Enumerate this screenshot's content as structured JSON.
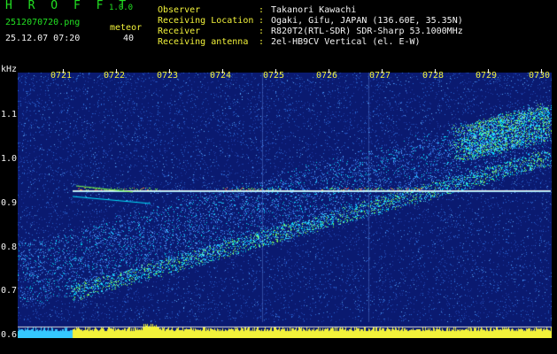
{
  "header": {
    "app_name": "H R O F F T",
    "version": "1.0.0",
    "file_name": "2512070720.png",
    "datetime": "25.12.07 07:20",
    "meteor_label": "meteor",
    "meteor_count": "40"
  },
  "info": {
    "rows": [
      {
        "label": "Observer",
        "value": "Takanori Kawachi"
      },
      {
        "label": "Receiving Location",
        "value": "Ogaki, Gifu, JAPAN (136.60E, 35.35N)"
      },
      {
        "label": "Receiver",
        "value": "R820T2(RTL-SDR) SDR-Sharp 53.1000MHz"
      },
      {
        "label": "Receiving antenna",
        "value": "2el-HB9CV Vertical (el. E-W)"
      }
    ],
    "separator": ":"
  },
  "spectrogram": {
    "y_unit": "kHz",
    "y_ticks": [
      "1.1",
      "1.0",
      "0.9",
      "0.8",
      "0.7",
      "0.6"
    ],
    "x_ticks": [
      "0721",
      "0722",
      "0723",
      "0724",
      "0725",
      "0726",
      "0727",
      "0728",
      "0729",
      "0730"
    ],
    "colors": {
      "background": "#0a1a70",
      "noise": "#2a6ad8",
      "signal": "#00e5ff",
      "meteor": "#7cff4a",
      "strong": "#ff5a3c",
      "carrier": "#e8e8e8",
      "level_bar": "#f2f23a",
      "level_bar_start": "#35c8ff"
    }
  }
}
